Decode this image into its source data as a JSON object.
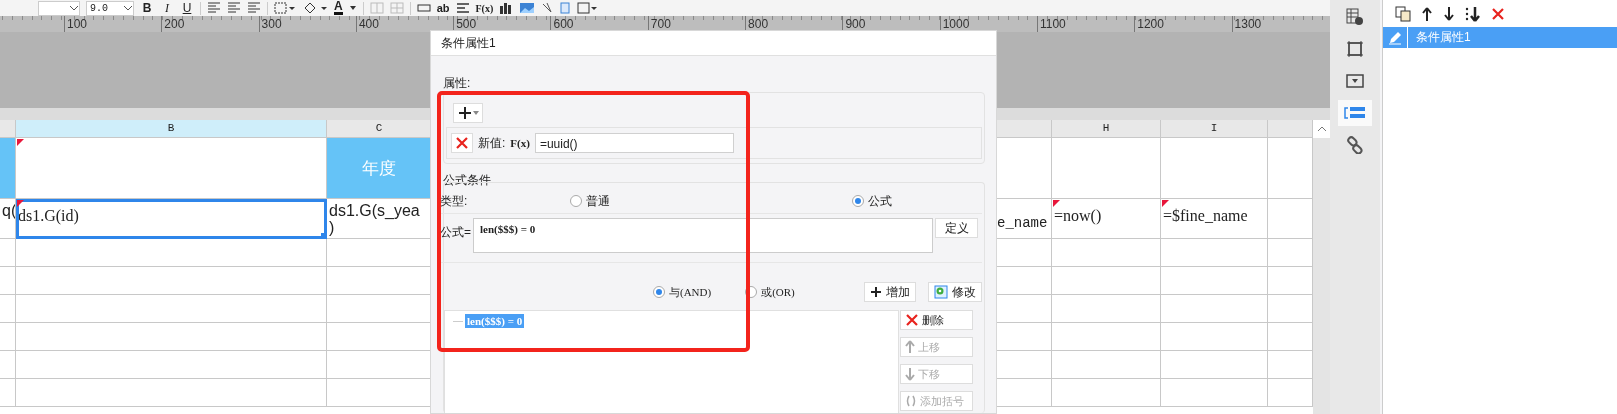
{
  "toolbar": {
    "font_size": "9.0",
    "buttons": [
      {
        "kind": "bold",
        "label": "B"
      },
      {
        "kind": "italic",
        "label": "I"
      },
      {
        "kind": "underline",
        "label": "U"
      }
    ],
    "font_color_label": "A",
    "text_label": "ab",
    "formula_label": "F(x)"
  },
  "ruler": {
    "ticks": [
      "100",
      "200",
      "300",
      "400",
      "500",
      "600",
      "700",
      "800",
      "900",
      "1000",
      "1100",
      "1200",
      "1300"
    ]
  },
  "sheet": {
    "columns": [
      {
        "selected": false
      },
      {
        "label": "B",
        "selected": true
      },
      {
        "label": "C",
        "selected": false
      },
      {
        "selected": false
      },
      {
        "label": "H",
        "selected": false
      },
      {
        "label": "I",
        "selected": false
      },
      {
        "selected": false
      }
    ],
    "rows": [
      {
        "cells": [
          {
            "kind": "header",
            "selected": false
          },
          {
            "kind": "plain",
            "flagged": true,
            "selected": false
          },
          {
            "text": "年度",
            "kind": "header",
            "selected": false
          },
          null,
          null,
          null,
          null
        ]
      },
      {
        "cells": [
          {
            "text": "q(",
            "kind": "plain",
            "selected": false
          },
          {
            "text": "ds1.G(id)",
            "kind": "mono",
            "flagged": true,
            "selected": true
          },
          {
            "text": "ds1.G(s_yea\n)",
            "kind": "plain",
            "selected": false
          },
          {
            "text": "e_name",
            "kind": "low",
            "selected": false
          },
          {
            "text": "=now()",
            "kind": "mono",
            "flagged": true,
            "selected": false
          },
          {
            "text": "=$fine_name",
            "kind": "mono",
            "flagged": true,
            "selected": false
          },
          null
        ]
      }
    ]
  },
  "dialog": {
    "title": "条件属性1",
    "property_label": "属性:",
    "new_value": {
      "label": "新值:",
      "formula_icon": "F(x)",
      "value": "=uuid()"
    },
    "condition_group": "公式条件",
    "type_label": "类型:",
    "type_options": [
      {
        "label": "普通",
        "selected": false
      },
      {
        "label": "公式",
        "selected": true
      }
    ],
    "formula_label": "公式=",
    "formula": "len($$$) = 0",
    "define_button": "定义",
    "logic_options": [
      {
        "label": "与(AND)",
        "selected": true
      },
      {
        "label": "或(OR)",
        "selected": false
      }
    ],
    "add_button": "增加",
    "modify_button": "修改",
    "conditions": [
      {
        "text": "len($$$) = 0",
        "selected": true
      }
    ],
    "side_buttons": [
      {
        "kind": "delete",
        "label": "删除",
        "disabled": false
      },
      {
        "kind": "up",
        "label": "上移",
        "disabled": true
      },
      {
        "kind": "down",
        "label": "下移",
        "disabled": true
      },
      {
        "kind": "paren",
        "label": "添加括号",
        "disabled": true
      }
    ]
  },
  "side_tabs": [
    {
      "kind": "info",
      "selected": false
    },
    {
      "kind": "frame",
      "selected": false
    },
    {
      "kind": "dropdown",
      "selected": false
    },
    {
      "kind": "condition",
      "selected": true
    },
    {
      "kind": "link",
      "selected": false
    }
  ],
  "panel": {
    "items": [
      {
        "label": "条件属性1",
        "selected": true
      }
    ]
  }
}
